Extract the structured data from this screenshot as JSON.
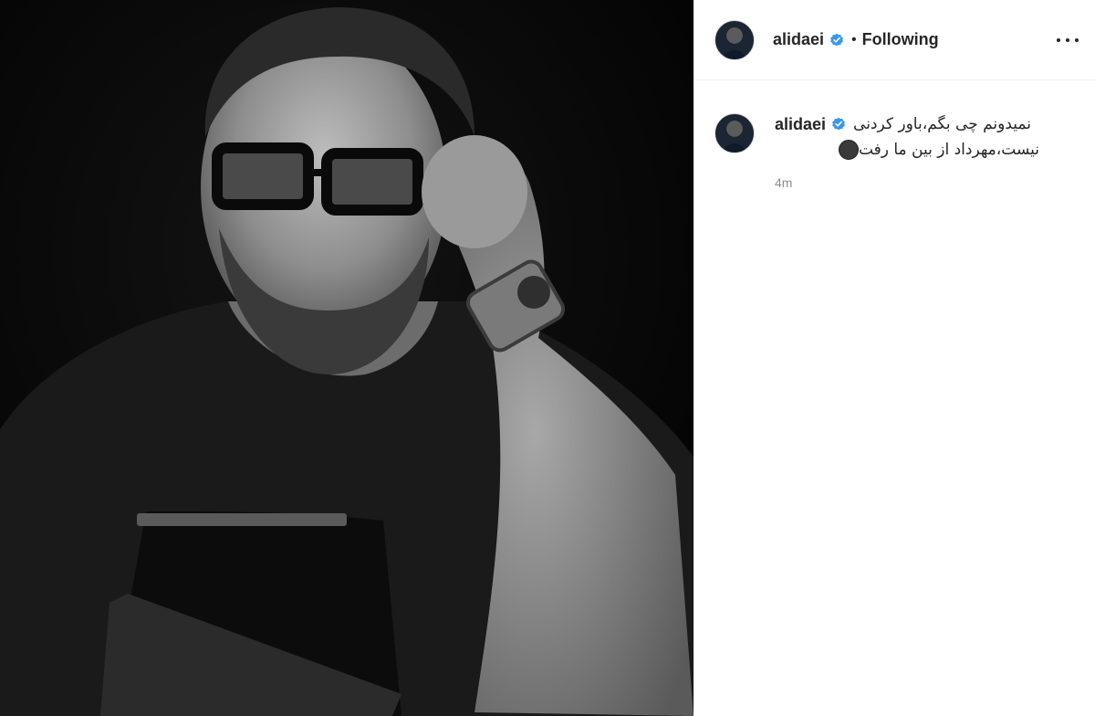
{
  "post": {
    "username": "alidaei",
    "separator": "•",
    "follow_status": "Following",
    "caption_line1": "نمیدونم چی بگم،باور کردنی",
    "caption_line2": "نیست،مهرداد از بین ما رفت",
    "timestamp": "4m"
  },
  "icons": {
    "verified": "verified-badge-icon",
    "more": "more-options-icon",
    "emoji": "black-circle-emoji"
  },
  "colors": {
    "text": "#262626",
    "muted": "#8e8e8e",
    "verified": "#3897f0",
    "border": "#efefef"
  }
}
